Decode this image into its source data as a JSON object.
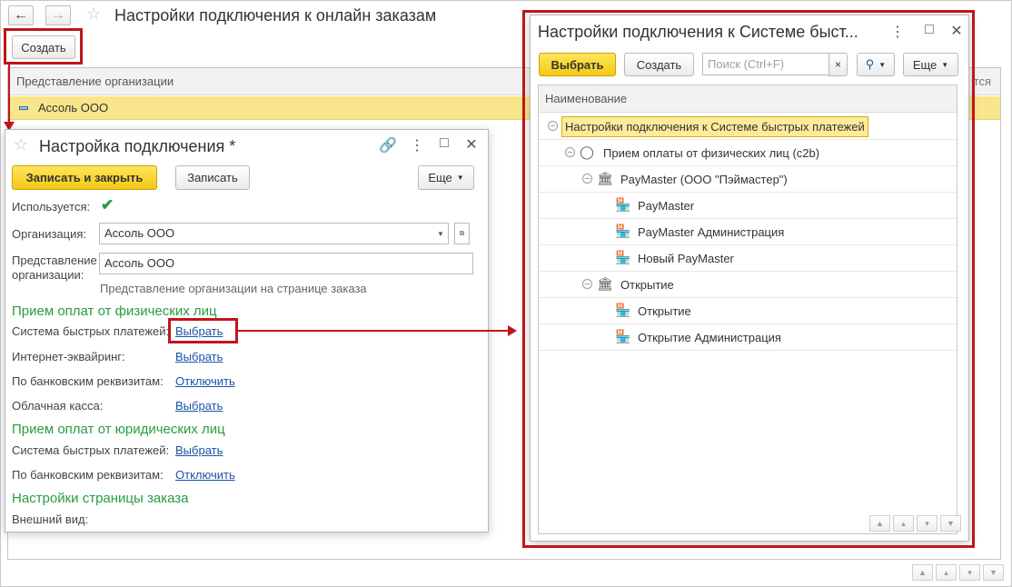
{
  "main": {
    "title": "Настройки подключения к онлайн заказам",
    "create_label": "Создать",
    "column_header": "Представление организации",
    "column_header_right": "тся",
    "rows": [
      {
        "label": "Ассоль ООО"
      }
    ]
  },
  "connection_dialog": {
    "title": "Настройка подключения *",
    "save_close_label": "Записать и закрыть",
    "save_label": "Записать",
    "more_label": "Еще",
    "used_label": "Используется:",
    "used_checked": "✔",
    "org_label": "Организация:",
    "org_value": "Ассоль ООО",
    "org_repr_label_1": "Представление",
    "org_repr_label_2": "организации:",
    "org_repr_value": "Ассоль ООО",
    "org_repr_hint": "Представление организации на странице заказа",
    "section_individuals": "Прием оплат от физических лиц",
    "section_legal": "Прием оплат от юридических лиц",
    "section_page": "Настройки страницы заказа",
    "individuals": [
      {
        "label": "Система быстрых платежей:",
        "action": "Выбрать"
      },
      {
        "label": "Интернет-эквайринг:",
        "action": "Выбрать"
      },
      {
        "label": "По банковским реквизитам:",
        "action": "Отключить"
      },
      {
        "label": "Облачная касса:",
        "action": "Выбрать"
      }
    ],
    "legal": [
      {
        "label": "Система быстрых платежей:",
        "action": "Выбрать"
      },
      {
        "label": "По банковским реквизитам:",
        "action": "Отключить"
      }
    ],
    "appearance_label": "Внешний вид:"
  },
  "sbp_dialog": {
    "title": "Настройки подключения к Системе быст...",
    "choose_label": "Выбрать",
    "create_label": "Создать",
    "search_placeholder": "Поиск (Ctrl+F)",
    "search_clear": "×",
    "more_label": "Еще",
    "column_header": "Наименование",
    "tree": [
      {
        "label": "Настройки подключения к Системе быстрых платежей",
        "icon": "root-folder-icon"
      },
      {
        "label": "Прием оплаты от физических лиц (c2b)",
        "icon": "person-icon"
      },
      {
        "label": "PayMaster (ООО \"Пэймастер\")",
        "icon": "bank-icon"
      },
      {
        "label": "PayMaster",
        "icon": "store-icon"
      },
      {
        "label": "PayMaster Администрация",
        "icon": "store-icon"
      },
      {
        "label": "Новый PayMaster",
        "icon": "store-icon"
      },
      {
        "label": "Открытие",
        "icon": "bank-icon"
      },
      {
        "label": "Открытие",
        "icon": "store-icon"
      },
      {
        "label": "Открытие Администрация",
        "icon": "store-icon"
      }
    ]
  },
  "colors": {
    "accent_yellow": "#f4c916",
    "selection_yellow": "#f9e68a",
    "link_blue": "#1a54a7",
    "section_green": "#2a9c3f",
    "annotation_red": "#c0151b"
  }
}
